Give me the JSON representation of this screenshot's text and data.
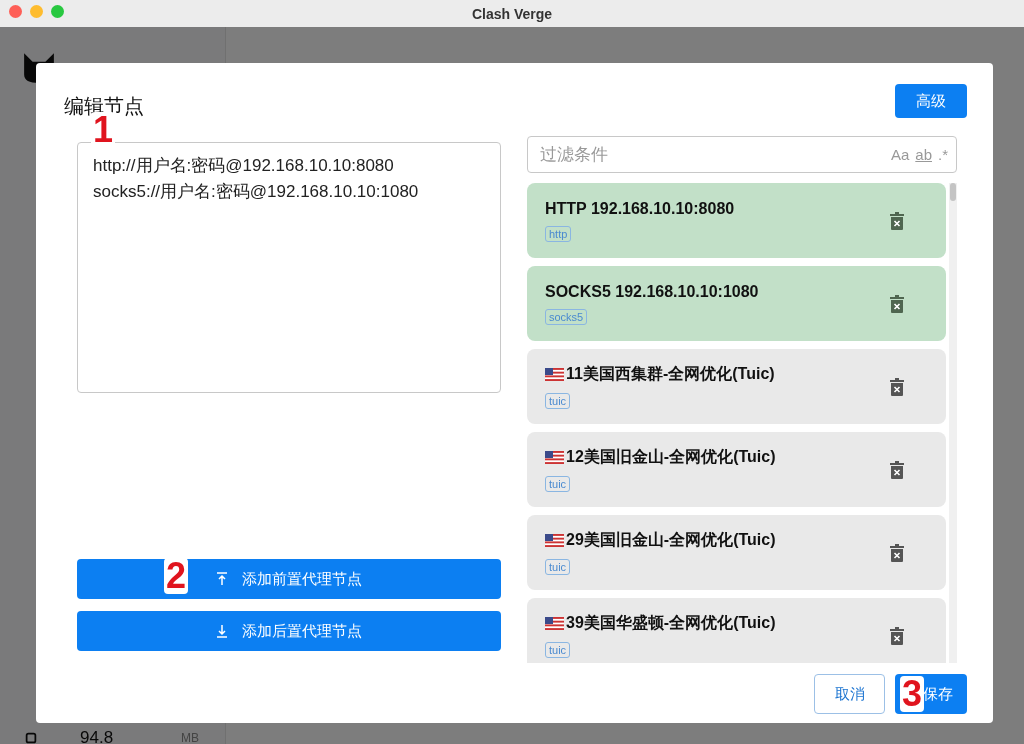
{
  "window": {
    "title": "Clash Verge"
  },
  "background": {
    "memory_value": "94.8",
    "memory_unit": "MB"
  },
  "dialog": {
    "title": "编辑节点",
    "advanced_button": "高级",
    "editor": {
      "value": "http://用户名:密码@192.168.10.10:8080\nsocks5://用户名:密码@192.168.10.10:1080"
    },
    "prepend_button": "添加前置代理节点",
    "append_button": "添加后置代理节点",
    "filter": {
      "placeholder": "过滤条件",
      "options": [
        "Aa",
        "ab",
        ".*"
      ]
    },
    "nodes": [
      {
        "name": "HTTP 192.168.10.10:8080",
        "tag": "http",
        "added": true,
        "flag": false
      },
      {
        "name": "SOCKS5 192.168.10.10:1080",
        "tag": "socks5",
        "added": true,
        "flag": false
      },
      {
        "name": "11美国西集群-全网优化(Tuic)",
        "tag": "tuic",
        "added": false,
        "flag": true
      },
      {
        "name": "12美国旧金山-全网优化(Tuic)",
        "tag": "tuic",
        "added": false,
        "flag": true
      },
      {
        "name": "29美国旧金山-全网优化(Tuic)",
        "tag": "tuic",
        "added": false,
        "flag": true
      },
      {
        "name": "39美国华盛顿-全网优化(Tuic)",
        "tag": "tuic",
        "added": false,
        "flag": true
      }
    ],
    "buttons": {
      "cancel": "取消",
      "save": "保存"
    }
  },
  "annotations": [
    "1",
    "2",
    "3"
  ]
}
